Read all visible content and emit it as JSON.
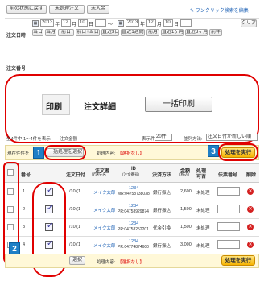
{
  "toolbar": {
    "btn_prev": "前の状態に戻す",
    "btn_unprocessed": "未処理注文",
    "btn_unpaid": "未入金",
    "help_link": "ワンクリック検索を編集"
  },
  "filter": {
    "order_date_label": "注文日時",
    "from_year": "2013",
    "from_month": "12",
    "from_day": "10",
    "from_hour": "",
    "to_year": "2013",
    "to_month": "12",
    "to_day": "10",
    "to_hour": "",
    "year_unit": "年",
    "month_unit": "月",
    "day_unit": "日",
    "tilde": "〜",
    "clear": "クリア",
    "quick": [
      "当日",
      "当月",
      "前日",
      "前日+当日",
      "直近3日",
      "直近1週間",
      "前月",
      "直近1ヶ月",
      "直近3ヶ月",
      "前年"
    ],
    "order_no_label": "注文番号"
  },
  "popup": {
    "tab_print": "印刷",
    "tab_detail": "注文詳細",
    "bulk_print": "一括印刷"
  },
  "list_info": {
    "summary": "全4件中 1〜4件を表示",
    "summary2": "注文金額",
    "per_page_label": "表示件数:",
    "per_page": "20件",
    "sort_label": "並列方法:",
    "sort": "注文日付が新しい順"
  },
  "bulk_bar": {
    "select_label": "現在件件を",
    "select_button": "一括処理を選択",
    "content_label": "処理内容:",
    "content_value": "【選択なし】",
    "exec_button": "処理を実行"
  },
  "table": {
    "headers": {
      "num": "番号",
      "date": "注文日付",
      "customer": "注文者",
      "customer_sub": "配送先名",
      "id": "ID",
      "id_sub": "(注文番号)",
      "payment": "決済方法",
      "amount": "金額",
      "amount_sub": "(税込)",
      "status": "処理",
      "status_sub": "可否",
      "slip": "伝票番号",
      "delete": "削除"
    },
    "rows": [
      {
        "num": "1",
        "date": "/10 (1",
        "customer": "メイク太郎",
        "id": "1234",
        "id_sub": "MR:04758738038",
        "payment": "銀行振込",
        "amount": "2,600",
        "status": "未処理"
      },
      {
        "num": "2",
        "date": "/10 (1",
        "customer": "メイク太郎",
        "id": "1234",
        "id_sub": "PR:04758929874",
        "payment": "銀行振込",
        "amount": "1,500",
        "status": "未処理"
      },
      {
        "num": "3",
        "date": "/10 (1",
        "customer": "メイク太郎",
        "id": "1234",
        "id_sub": "PR:04758252201",
        "payment": "代金引換",
        "amount": "1,500",
        "status": "未処理"
      },
      {
        "num": "4",
        "date": "/10 (1",
        "customer": "メイク太郎",
        "id": "1234",
        "id_sub": "PR:04774874600",
        "payment": "銀行振込",
        "amount": "3,000",
        "status": "未処理"
      }
    ]
  },
  "bottom_bar": {
    "select_button": "選択",
    "content_label": "処理内容:",
    "content_value": "【選択なし】",
    "exec_button": "処理を実行"
  },
  "badges": {
    "b1": "1",
    "b2": "2",
    "b3": "3"
  },
  "colors": {
    "accent_red": "#e00000",
    "badge_blue": "#1f7fc6",
    "exec_yellow": "#f7b500"
  }
}
